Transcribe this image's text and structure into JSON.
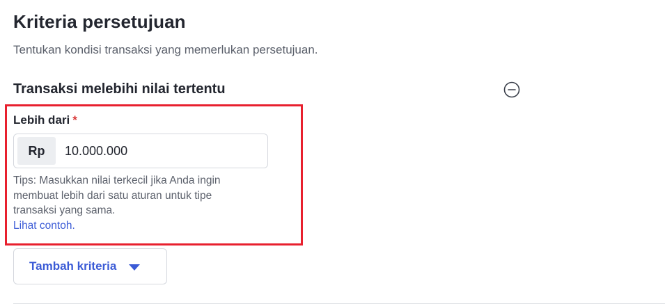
{
  "header": {
    "title": "Kriteria persetujuan",
    "subtitle": "Tentukan kondisi transaksi yang memerlukan persetujuan."
  },
  "section": {
    "title": "Transaksi melebihi nilai tertentu",
    "remove_icon": "minus-circle-icon"
  },
  "field": {
    "label": "Lebih dari",
    "required_mark": "*",
    "currency_prefix": "Rp",
    "value": "10.000.000",
    "tips": "Tips: Masukkan nilai terkecil jika Anda ingin membuat lebih dari satu aturan untuk tipe transaksi yang sama.",
    "tips_link": "Lihat contoh."
  },
  "actions": {
    "add_criteria_label": "Tambah kriteria",
    "add_criteria_icon": "caret-down-icon"
  },
  "colors": {
    "accent": "#3b5bd6",
    "highlight": "#e8202e",
    "required": "#d93a3a"
  }
}
